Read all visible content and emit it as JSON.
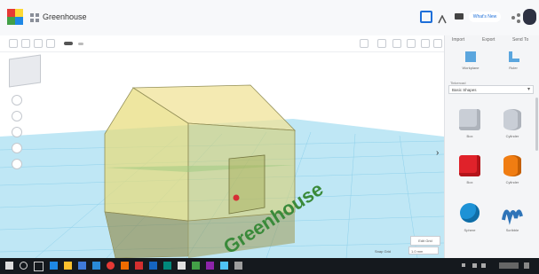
{
  "app": {
    "title": "Greenhouse"
  },
  "header": {
    "user_label": "What's New"
  },
  "right_panel": {
    "tabs": [
      "Import",
      "Export",
      "Send To"
    ],
    "tools": [
      {
        "label": "Workplane"
      },
      {
        "label": "Ruler"
      }
    ],
    "category_label": "Tinkercad",
    "category_value": "Basic Shapes",
    "shapes": [
      {
        "label": "Box",
        "color": "#c9ced6",
        "icon": "box-gray"
      },
      {
        "label": "Cylinder",
        "color": "#c9ced6",
        "icon": "cylinder-gray"
      },
      {
        "label": "Box",
        "color": "#e0222a",
        "icon": "box-red"
      },
      {
        "label": "Cylinder",
        "color": "#f07d12",
        "icon": "cylinder-orange"
      },
      {
        "label": "Sphere",
        "color": "#1d92d6",
        "icon": "sphere-blue"
      },
      {
        "label": "Scribble",
        "color": "#2f74b8",
        "icon": "scribble-blue"
      }
    ]
  },
  "viewport": {
    "scene_text": "Greenhouse",
    "edit_grid_label": "Edit Grid",
    "snap_grid_label": "Snap Grid",
    "snap_grid_value": "1.0 mm"
  },
  "colors": {
    "accent": "#1e6fd9",
    "grid": "#9fd8ef",
    "house_fill": "#e8dc7a",
    "text_3d": "#3a8a3a"
  }
}
